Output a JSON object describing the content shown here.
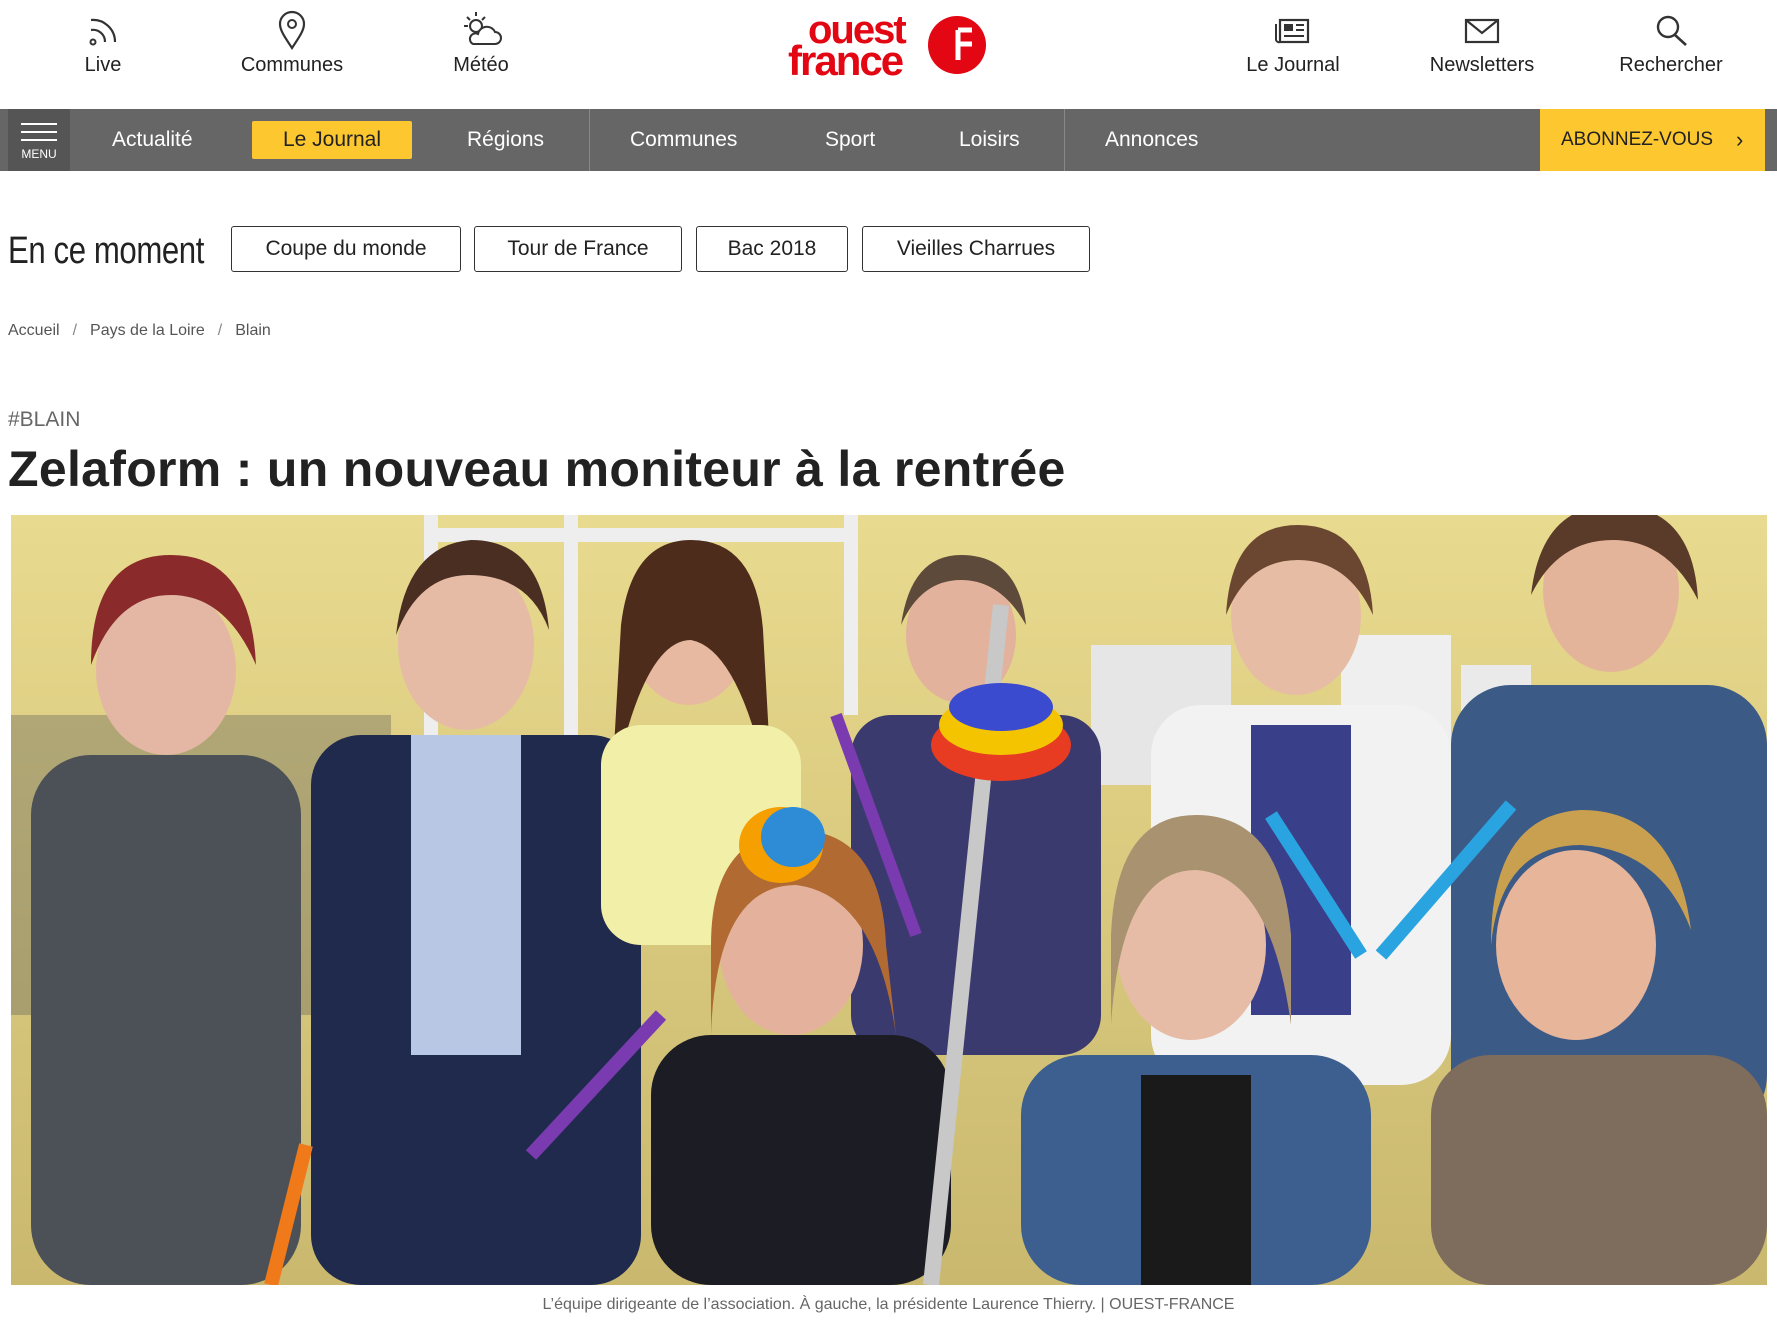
{
  "topbar": {
    "left_items": [
      {
        "label": "Live",
        "icon": "rss-icon"
      },
      {
        "label": "Communes",
        "icon": "map-pin-icon"
      },
      {
        "label": "Météo",
        "icon": "weather-icon"
      }
    ],
    "logo": {
      "line1": "ouest",
      "line2": "france",
      "color": "#e30613"
    },
    "right_items": [
      {
        "label": "Le Journal",
        "icon": "newspaper-icon"
      },
      {
        "label": "Newsletters",
        "icon": "mail-icon"
      },
      {
        "label": "Rechercher",
        "icon": "search-icon"
      }
    ]
  },
  "nav": {
    "menu_label": "MENU",
    "items": [
      "Actualité",
      "Le Journal",
      "Régions",
      "Communes",
      "Sport",
      "Loisirs",
      "Annonces"
    ],
    "active_item": "Le Journal",
    "subscribe_label": "ABONNEZ-VOUS",
    "subscribe_chevron": "›",
    "colors": {
      "bar": "#666666",
      "accent": "#fdc82f"
    }
  },
  "trending": {
    "title": "En ce moment",
    "tags": [
      "Coupe du monde",
      "Tour de France",
      "Bac 2018",
      "Vieilles Charrues"
    ]
  },
  "breadcrumb": {
    "items": [
      "Accueil",
      "Pays de la Loire",
      "Blain"
    ],
    "separator": "/"
  },
  "article": {
    "kicker": "#BLAIN",
    "title": "Zelaform : un nouveau moniteur à la rentrée",
    "photo_caption": "L’équipe dirigeante de l’association. À gauche, la présidente Laurence Thierry. | OUEST-FRANCE"
  }
}
